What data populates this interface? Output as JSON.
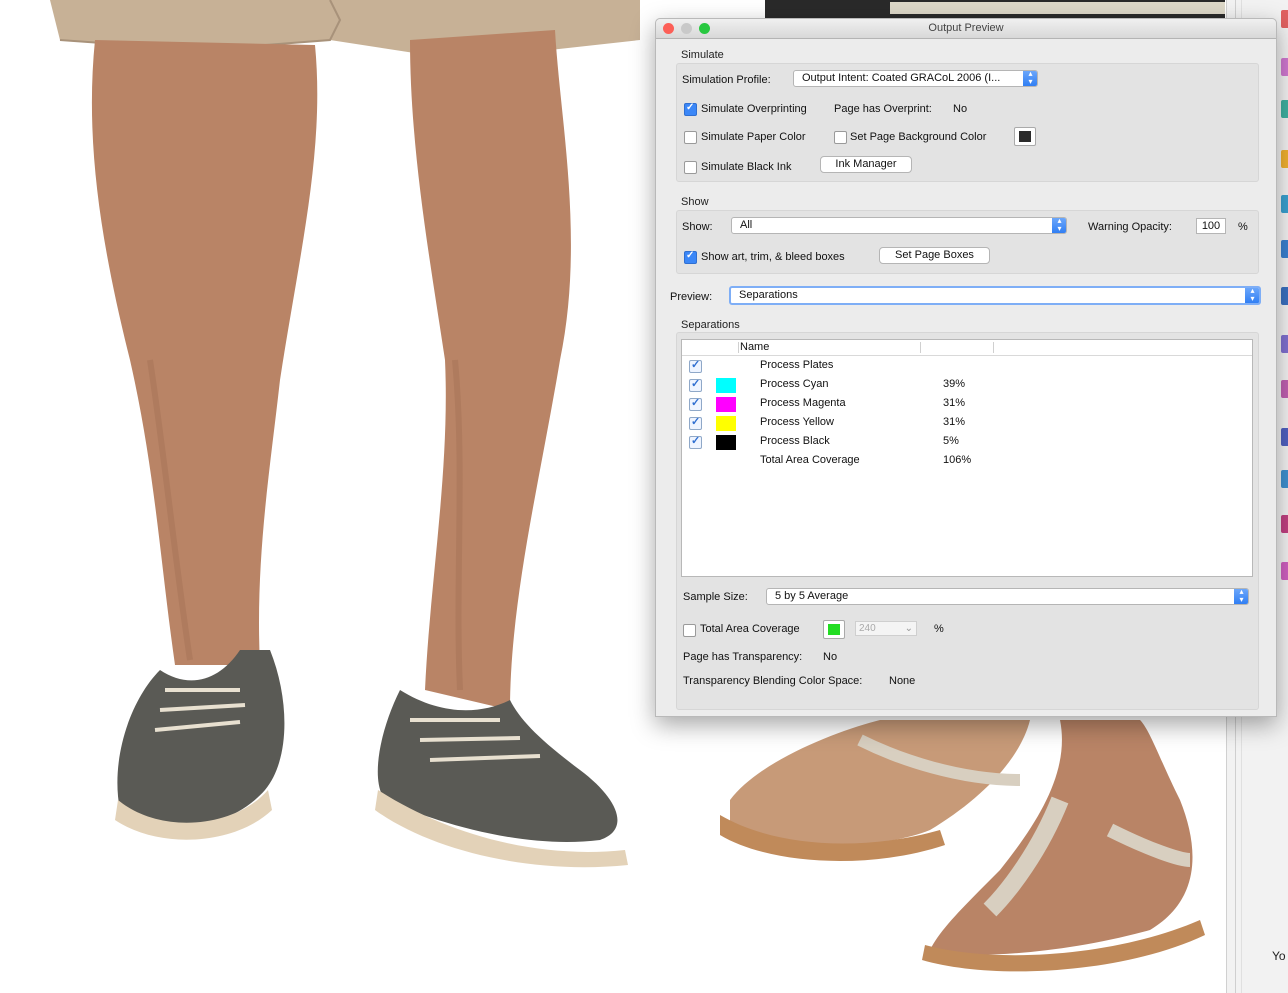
{
  "window": {
    "title": "Output Preview"
  },
  "simulate": {
    "section_label": "Simulate",
    "profile_label": "Simulation Profile:",
    "profile_value": "Output Intent: Coated GRACoL 2006 (I...",
    "overprinting_label": "Simulate Overprinting",
    "overprinting_checked": true,
    "page_overprint_label": "Page has Overprint:",
    "page_overprint_value": "No",
    "paper_color_label": "Simulate Paper Color",
    "paper_color_checked": false,
    "page_bg_label": "Set Page Background Color",
    "page_bg_checked": false,
    "page_bg_color": "#2b2b2b",
    "black_ink_label": "Simulate Black Ink",
    "black_ink_checked": false,
    "ink_manager_label": "Ink Manager"
  },
  "show": {
    "section_label": "Show",
    "show_label": "Show:",
    "show_value": "All",
    "warning_opacity_label": "Warning Opacity:",
    "warning_opacity_value": "100",
    "percent": "%",
    "boxes_label": "Show art, trim, & bleed boxes",
    "boxes_checked": true,
    "set_page_boxes_label": "Set Page Boxes"
  },
  "preview": {
    "label": "Preview:",
    "value": "Separations"
  },
  "separations": {
    "section_label": "Separations",
    "name_header": "Name",
    "rows": [
      {
        "name": "Process Plates",
        "value": "",
        "checked": true,
        "color": ""
      },
      {
        "name": "Process Cyan",
        "value": "39%",
        "checked": true,
        "color": "#00ffff"
      },
      {
        "name": "Process Magenta",
        "value": "31%",
        "checked": true,
        "color": "#ff00ff"
      },
      {
        "name": "Process Yellow",
        "value": "31%",
        "checked": true,
        "color": "#ffff00"
      },
      {
        "name": "Process Black",
        "value": "5%",
        "checked": true,
        "color": "#000000"
      },
      {
        "name": "Total Area Coverage",
        "value": "106%",
        "checked": false,
        "color": ""
      }
    ]
  },
  "sample": {
    "label": "Sample Size:",
    "value": "5 by 5 Average",
    "tac_label": "Total Area Coverage",
    "tac_checked": false,
    "tac_color": "#22dd22",
    "tac_value": "240",
    "tac_percent": "%",
    "transparency_label": "Page has Transparency:",
    "transparency_value": "No",
    "blending_label": "Transparency Blending Color Space:",
    "blending_value": "None"
  },
  "background": {
    "partial_text": "Yo"
  },
  "colors": {
    "accent": "#3b87f7",
    "close": "#fc5f57",
    "minimize": "#fdbc2e",
    "zoom": "#28c840"
  }
}
